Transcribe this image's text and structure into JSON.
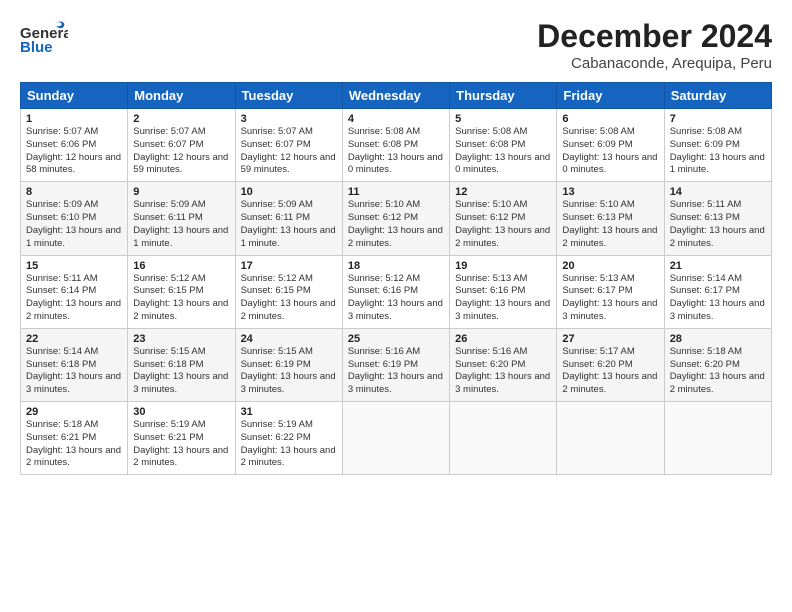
{
  "header": {
    "logo_general": "General",
    "logo_blue": "Blue",
    "title": "December 2024",
    "subtitle": "Cabanaconde, Arequipa, Peru"
  },
  "days_of_week": [
    "Sunday",
    "Monday",
    "Tuesday",
    "Wednesday",
    "Thursday",
    "Friday",
    "Saturday"
  ],
  "weeks": [
    [
      {
        "day": "1",
        "sunrise": "5:07 AM",
        "sunset": "6:06 PM",
        "daylight": "12 hours and 58 minutes."
      },
      {
        "day": "2",
        "sunrise": "5:07 AM",
        "sunset": "6:07 PM",
        "daylight": "12 hours and 59 minutes."
      },
      {
        "day": "3",
        "sunrise": "5:07 AM",
        "sunset": "6:07 PM",
        "daylight": "12 hours and 59 minutes."
      },
      {
        "day": "4",
        "sunrise": "5:08 AM",
        "sunset": "6:08 PM",
        "daylight": "13 hours and 0 minutes."
      },
      {
        "day": "5",
        "sunrise": "5:08 AM",
        "sunset": "6:08 PM",
        "daylight": "13 hours and 0 minutes."
      },
      {
        "day": "6",
        "sunrise": "5:08 AM",
        "sunset": "6:09 PM",
        "daylight": "13 hours and 0 minutes."
      },
      {
        "day": "7",
        "sunrise": "5:08 AM",
        "sunset": "6:09 PM",
        "daylight": "13 hours and 1 minute."
      }
    ],
    [
      {
        "day": "8",
        "sunrise": "5:09 AM",
        "sunset": "6:10 PM",
        "daylight": "13 hours and 1 minute."
      },
      {
        "day": "9",
        "sunrise": "5:09 AM",
        "sunset": "6:11 PM",
        "daylight": "13 hours and 1 minute."
      },
      {
        "day": "10",
        "sunrise": "5:09 AM",
        "sunset": "6:11 PM",
        "daylight": "13 hours and 1 minute."
      },
      {
        "day": "11",
        "sunrise": "5:10 AM",
        "sunset": "6:12 PM",
        "daylight": "13 hours and 2 minutes."
      },
      {
        "day": "12",
        "sunrise": "5:10 AM",
        "sunset": "6:12 PM",
        "daylight": "13 hours and 2 minutes."
      },
      {
        "day": "13",
        "sunrise": "5:10 AM",
        "sunset": "6:13 PM",
        "daylight": "13 hours and 2 minutes."
      },
      {
        "day": "14",
        "sunrise": "5:11 AM",
        "sunset": "6:13 PM",
        "daylight": "13 hours and 2 minutes."
      }
    ],
    [
      {
        "day": "15",
        "sunrise": "5:11 AM",
        "sunset": "6:14 PM",
        "daylight": "13 hours and 2 minutes."
      },
      {
        "day": "16",
        "sunrise": "5:12 AM",
        "sunset": "6:15 PM",
        "daylight": "13 hours and 2 minutes."
      },
      {
        "day": "17",
        "sunrise": "5:12 AM",
        "sunset": "6:15 PM",
        "daylight": "13 hours and 2 minutes."
      },
      {
        "day": "18",
        "sunrise": "5:12 AM",
        "sunset": "6:16 PM",
        "daylight": "13 hours and 3 minutes."
      },
      {
        "day": "19",
        "sunrise": "5:13 AM",
        "sunset": "6:16 PM",
        "daylight": "13 hours and 3 minutes."
      },
      {
        "day": "20",
        "sunrise": "5:13 AM",
        "sunset": "6:17 PM",
        "daylight": "13 hours and 3 minutes."
      },
      {
        "day": "21",
        "sunrise": "5:14 AM",
        "sunset": "6:17 PM",
        "daylight": "13 hours and 3 minutes."
      }
    ],
    [
      {
        "day": "22",
        "sunrise": "5:14 AM",
        "sunset": "6:18 PM",
        "daylight": "13 hours and 3 minutes."
      },
      {
        "day": "23",
        "sunrise": "5:15 AM",
        "sunset": "6:18 PM",
        "daylight": "13 hours and 3 minutes."
      },
      {
        "day": "24",
        "sunrise": "5:15 AM",
        "sunset": "6:19 PM",
        "daylight": "13 hours and 3 minutes."
      },
      {
        "day": "25",
        "sunrise": "5:16 AM",
        "sunset": "6:19 PM",
        "daylight": "13 hours and 3 minutes."
      },
      {
        "day": "26",
        "sunrise": "5:16 AM",
        "sunset": "6:20 PM",
        "daylight": "13 hours and 3 minutes."
      },
      {
        "day": "27",
        "sunrise": "5:17 AM",
        "sunset": "6:20 PM",
        "daylight": "13 hours and 2 minutes."
      },
      {
        "day": "28",
        "sunrise": "5:18 AM",
        "sunset": "6:20 PM",
        "daylight": "13 hours and 2 minutes."
      }
    ],
    [
      {
        "day": "29",
        "sunrise": "5:18 AM",
        "sunset": "6:21 PM",
        "daylight": "13 hours and 2 minutes."
      },
      {
        "day": "30",
        "sunrise": "5:19 AM",
        "sunset": "6:21 PM",
        "daylight": "13 hours and 2 minutes."
      },
      {
        "day": "31",
        "sunrise": "5:19 AM",
        "sunset": "6:22 PM",
        "daylight": "13 hours and 2 minutes."
      },
      null,
      null,
      null,
      null
    ]
  ]
}
